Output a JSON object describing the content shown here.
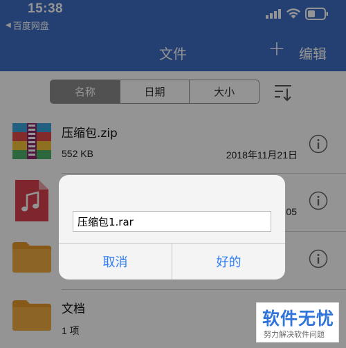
{
  "status_bar": {
    "time": "15:38",
    "back_app": "百度网盘"
  },
  "nav": {
    "title": "文件",
    "add_label": "+",
    "edit_label": "编辑"
  },
  "sort": {
    "segments": [
      "名称",
      "日期",
      "大小"
    ],
    "active": "名称"
  },
  "files": [
    {
      "name": "压缩包.zip",
      "size": "552 KB",
      "date": "2018年11月21日",
      "icon": "zip-archive-icon"
    },
    {
      "name": "",
      "size": "",
      "date": "05",
      "icon": "music-file-icon"
    },
    {
      "name": "",
      "size": "",
      "date": "",
      "icon": "folder-icon"
    },
    {
      "name": "文档",
      "size": "1 项",
      "date": "",
      "icon": "folder-icon"
    }
  ],
  "dialog": {
    "input_value": "压缩包1.rar",
    "cancel_label": "取消",
    "ok_label": "好的"
  },
  "watermark": {
    "main": "软件无忧",
    "sub": "努力解决软件问题"
  },
  "colors": {
    "nav_blue": "#3f6fc7",
    "dialog_button_blue": "#2f7ef6",
    "folder_orange": "#f0a93c",
    "music_red": "#d9414e"
  }
}
